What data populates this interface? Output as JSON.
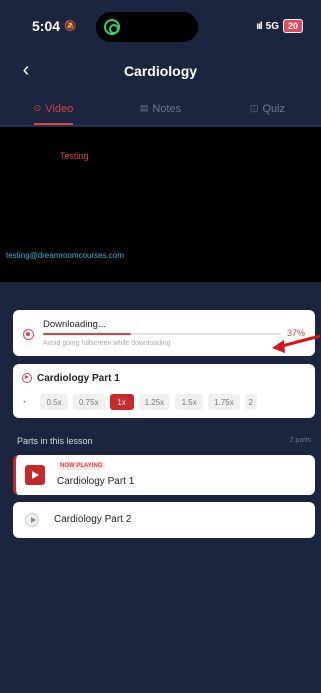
{
  "status_bar": {
    "time": "5:04",
    "bell_icon": "bell-off-icon",
    "signal": "ııl",
    "network": "5G",
    "battery": "20"
  },
  "header": {
    "title": "Cardiology",
    "back_icon": "chevron-left-icon"
  },
  "tabs": [
    {
      "label": "Video",
      "icon": "⊙",
      "active": true
    },
    {
      "label": "Notes",
      "icon": "▤",
      "active": false
    },
    {
      "label": "Quiz",
      "icon": "◫",
      "active": false
    }
  ],
  "video": {
    "watermark_name": "Testing",
    "watermark_email": "testing@dreamroomcourses.com"
  },
  "download": {
    "title": "Downloading...",
    "percent_label": "37%",
    "progress": 0.37,
    "hint": "Avoid going fullscreen while downloading"
  },
  "lesson": {
    "title": "Cardiology Part 1",
    "speeds": [
      "0.5x",
      "0.75x",
      "1x",
      "1.25x",
      "1.5x",
      "1.75x",
      "2"
    ],
    "active_speed": "1x"
  },
  "parts": {
    "heading": "Parts in this lesson",
    "count": "2 parts",
    "items": [
      {
        "badge": "NOW PLAYING",
        "title": "Cardiology Part 1"
      },
      {
        "title": "Cardiology Part 2"
      }
    ]
  },
  "colors": {
    "accent": "#c62b2b",
    "background": "#1b2540",
    "annotation_arrow": "#e0101a"
  }
}
